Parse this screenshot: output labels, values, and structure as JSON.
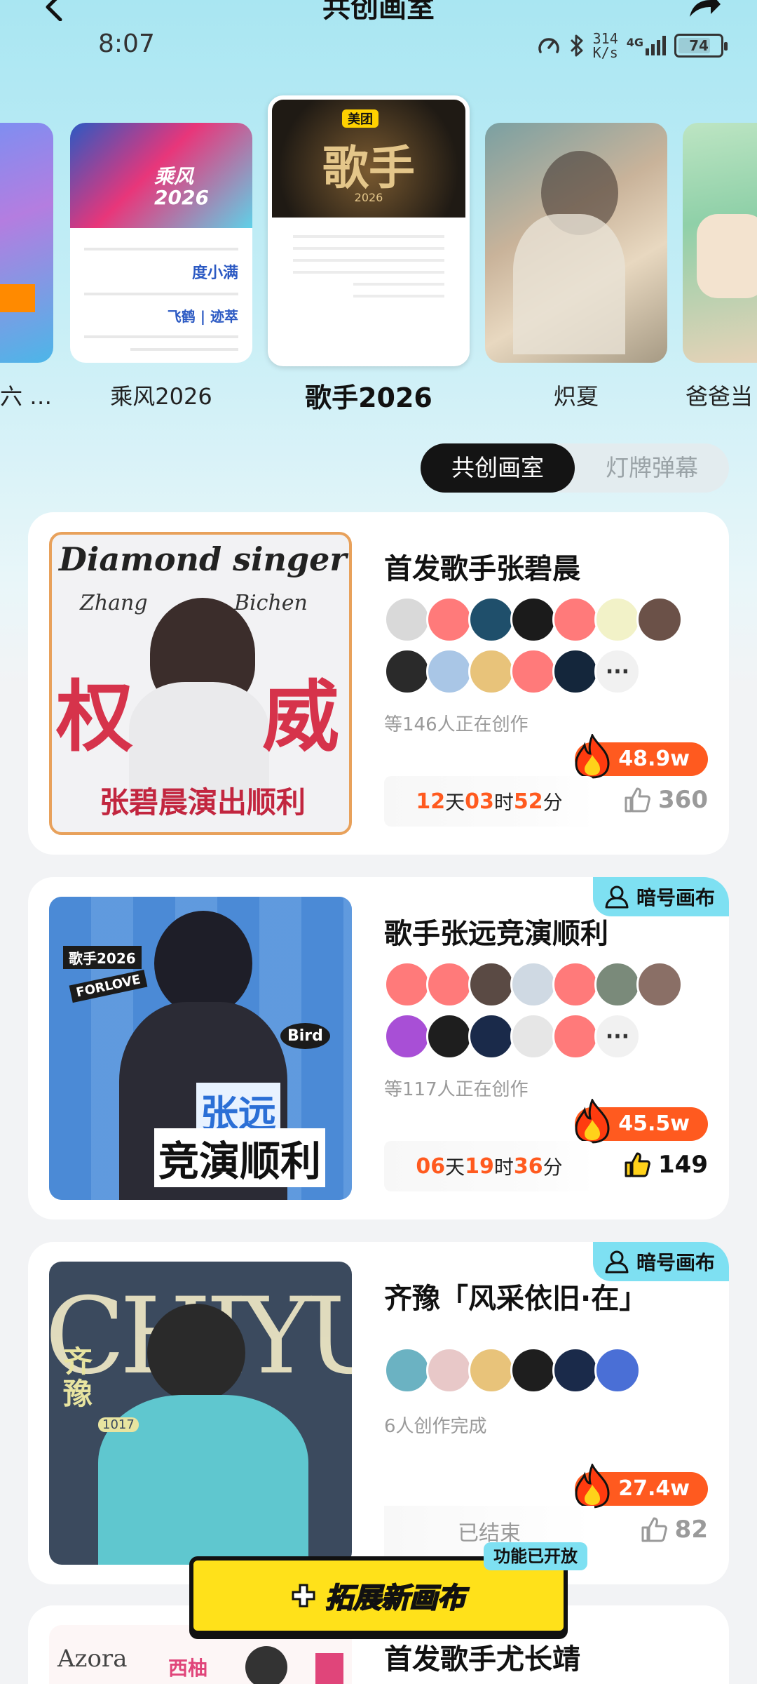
{
  "header": {
    "title": "共创画室"
  },
  "status_bar": {
    "time": "8:07",
    "net_speed_value": "314",
    "net_speed_unit": "K/s",
    "network": "4G",
    "battery": "74"
  },
  "shows": [
    {
      "label": "六 …",
      "active": false
    },
    {
      "label": "乘风2026",
      "active": false
    },
    {
      "label": "歌手2026",
      "active": true
    },
    {
      "label": "炽夏",
      "active": false
    },
    {
      "label": "爸爸当",
      "active": false
    }
  ],
  "poster_text": {
    "chengfeng_sponsor_1": "度小满",
    "chengfeng_sponsor_2": "飞鹤 | 迹萃",
    "chengfeng_logo": "乘风 2026",
    "geshou_brand": "美团",
    "geshou_logo": "歌手",
    "geshou_year": "2026"
  },
  "tabs": {
    "active": "共创画室",
    "inactive": "灯牌弹幕"
  },
  "cards": [
    {
      "title": "首发歌手张碧晨",
      "creators_text": "等146人正在创作",
      "heat": "48.9w",
      "timer": {
        "days": "12",
        "days_unit": "天",
        "hours": "03",
        "hours_unit": "时",
        "minutes": "52",
        "minutes_unit": "分"
      },
      "likes": "360",
      "liked": false,
      "art_text": {
        "line1": "Diamond singer",
        "line2a": "Zhang",
        "line2b": "Bichen",
        "big_left": "权",
        "big_right": "威",
        "bottom": "张碧晨演出顺利"
      }
    },
    {
      "title": "歌手张远竞演顺利",
      "badge": "暗号画布",
      "creators_text": "等117人正在创作",
      "heat": "45.5w",
      "timer": {
        "days": "06",
        "days_unit": "天",
        "hours": "19",
        "hours_unit": "时",
        "minutes": "36",
        "minutes_unit": "分"
      },
      "likes": "149",
      "liked": true,
      "art_text": {
        "tag1": "歌手2026",
        "tag2": "FORLOVE",
        "tag3": "Bird",
        "name": "张远",
        "slogan": "竞演顺利"
      }
    },
    {
      "title": "齐豫「风采依旧·在」",
      "badge": "暗号画布",
      "creators_text": "6人创作完成",
      "heat": "27.4w",
      "ended_text": "已结束",
      "likes": "82",
      "liked": false,
      "art_text": {
        "bg": "CHIYU",
        "name": "齐豫",
        "date": "1017"
      }
    },
    {
      "title": "首发歌手尤长靖",
      "art_text": {
        "word": "Azora",
        "sub": "西柚"
      }
    }
  ],
  "expand_button": {
    "label": "拓展新画布",
    "tag": "功能已开放"
  },
  "colors": {
    "accent": "#ff5a1f",
    "badge": "#7ee0f2",
    "button": "#ffe11a"
  }
}
